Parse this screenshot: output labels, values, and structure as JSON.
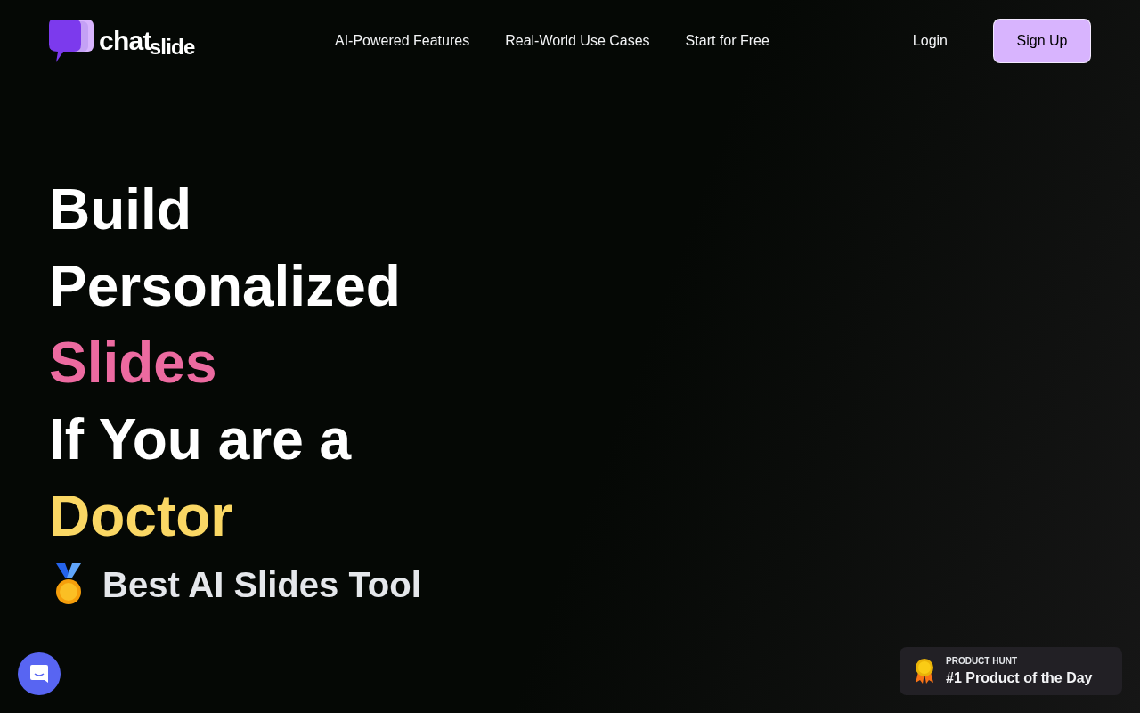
{
  "logo": {
    "word_1": "chat",
    "word_2": "slide"
  },
  "nav": {
    "links": [
      "AI-Powered Features",
      "Real-World Use Cases",
      "Start for Free"
    ],
    "login": "Login",
    "signup": "Sign Up"
  },
  "hero": {
    "lines": [
      {
        "text": "Build",
        "color": "#ffffff"
      },
      {
        "text": "Personalized",
        "color": "#ffffff"
      },
      {
        "text": "Slides",
        "color": "#ec6aa0"
      },
      {
        "text": "If You are a",
        "color": "#ffffff"
      },
      {
        "text": "Doctor",
        "color": "#fad764"
      }
    ],
    "award": "Best AI Slides Tool"
  },
  "badge": {
    "overline": "PRODUCT HUNT",
    "title": "#1 Product of the Day"
  }
}
